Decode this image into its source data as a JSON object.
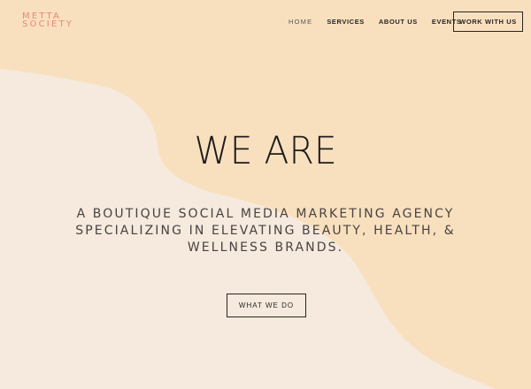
{
  "brand": {
    "line1": "METTA",
    "line2": "SOCIETY"
  },
  "nav": {
    "items": [
      {
        "label": "HOME"
      },
      {
        "label": "SERVICES"
      },
      {
        "label": "ABOUT US"
      },
      {
        "label": "EVENTS"
      }
    ],
    "cta_label": "WORK WITH US"
  },
  "hero": {
    "title": "WE ARE",
    "subtitle_lines": [
      "A BOUTIQUE SOCIAL MEDIA MARKETING AGENCY",
      "SPECIALIZING IN ELEVATING BEAUTY, HEALTH, &",
      "WELLNESS BRANDS."
    ],
    "button_label": "WHAT WE DO"
  },
  "colors": {
    "background": "#f8e0bf",
    "blob": "#f5eadd",
    "brand_accent": "#ec8676",
    "text": "#2a2524"
  }
}
